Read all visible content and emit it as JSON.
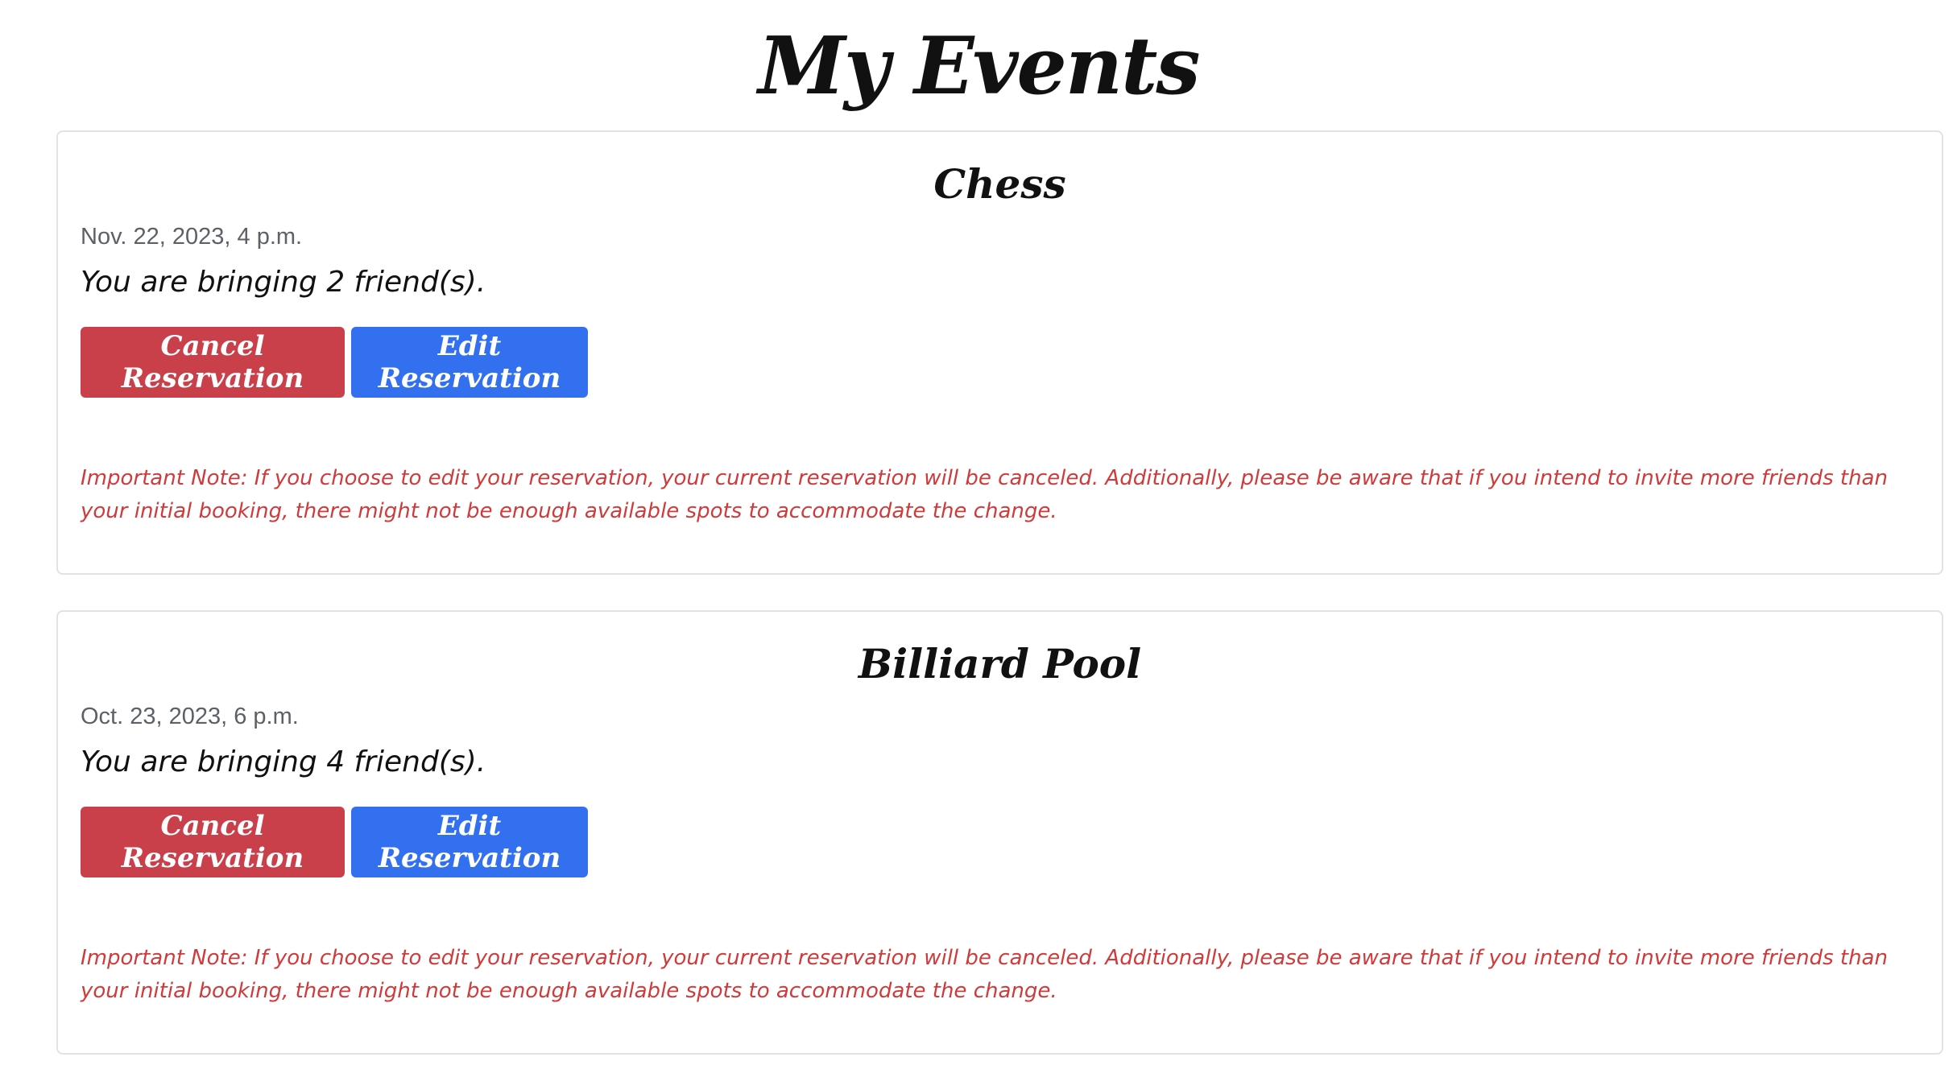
{
  "page": {
    "title": "My Events"
  },
  "events": [
    {
      "name": "Chess",
      "date": "Nov. 22, 2023, 4 p.m.",
      "guests_text": "You are bringing 2 friend(s).",
      "cancel_label": "Cancel Reservation",
      "edit_label": "Edit Reservation",
      "note": "Important Note: If you choose to edit your reservation, your current reservation will be canceled. Additionally, please be aware that if you intend to invite more friends than your initial booking, there might not be enough available spots to accommodate the change."
    },
    {
      "name": "Billiard Pool",
      "date": "Oct. 23, 2023, 6 p.m.",
      "guests_text": "You are bringing 4 friend(s).",
      "cancel_label": "Cancel Reservation",
      "edit_label": "Edit Reservation",
      "note": "Important Note: If you choose to edit your reservation, your current reservation will be canceled. Additionally, please be aware that if you intend to invite more friends than your initial booking, there might not be enough available spots to accommodate the change."
    }
  ],
  "colors": {
    "cancel": "#c9404a",
    "edit": "#3370f0",
    "note": "#d03a3a"
  }
}
